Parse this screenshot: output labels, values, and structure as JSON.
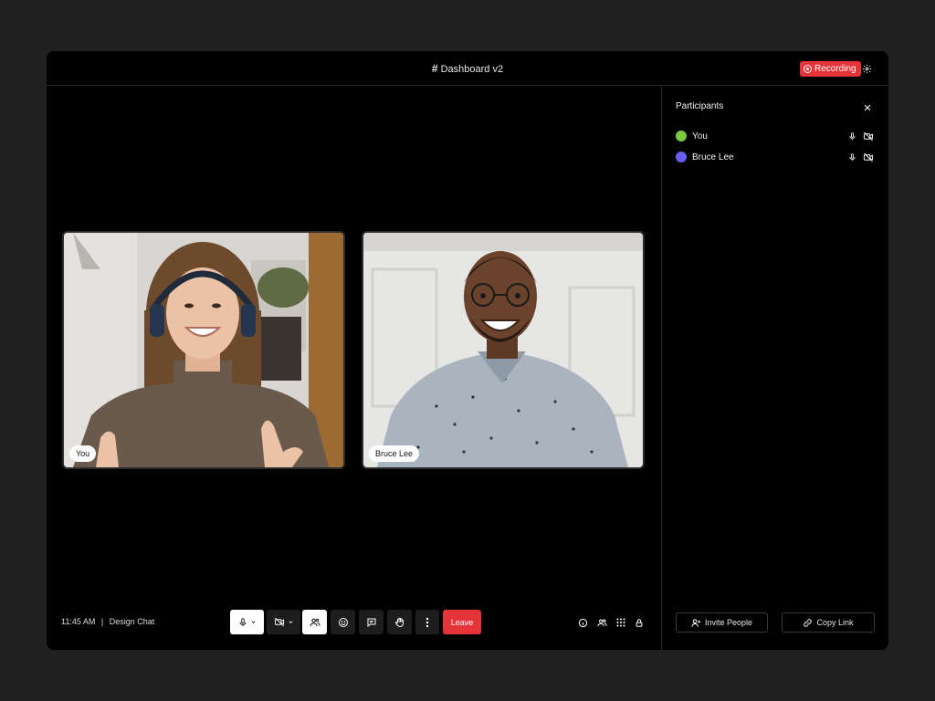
{
  "header": {
    "title": "Dashboard v2",
    "hash_symbol": "#",
    "recording_label": "Recording",
    "recording_color": "#e5333a"
  },
  "tiles": [
    {
      "name": "You"
    },
    {
      "name": "Bruce Lee"
    }
  ],
  "footer": {
    "time": "11:45 AM",
    "separator": "|",
    "meeting_name": "Design Chat",
    "leave_label": "Leave"
  },
  "panel": {
    "title": "Participants",
    "participants": [
      {
        "name": "You",
        "color": "#7ac943"
      },
      {
        "name": "Bruce Lee",
        "color": "#6a5cf0"
      }
    ],
    "invite_label": "Invite People",
    "copy_label": "Copy Link"
  },
  "icons": [
    "hash-icon",
    "record-icon",
    "gear-icon",
    "mic-icon",
    "camera-off-icon",
    "chevron-down-icon",
    "people-icon",
    "emoji-icon",
    "chat-icon",
    "hand-icon",
    "more-icon",
    "info-icon",
    "grid-icon",
    "lock-icon",
    "close-icon",
    "add-user-icon",
    "link-icon"
  ]
}
